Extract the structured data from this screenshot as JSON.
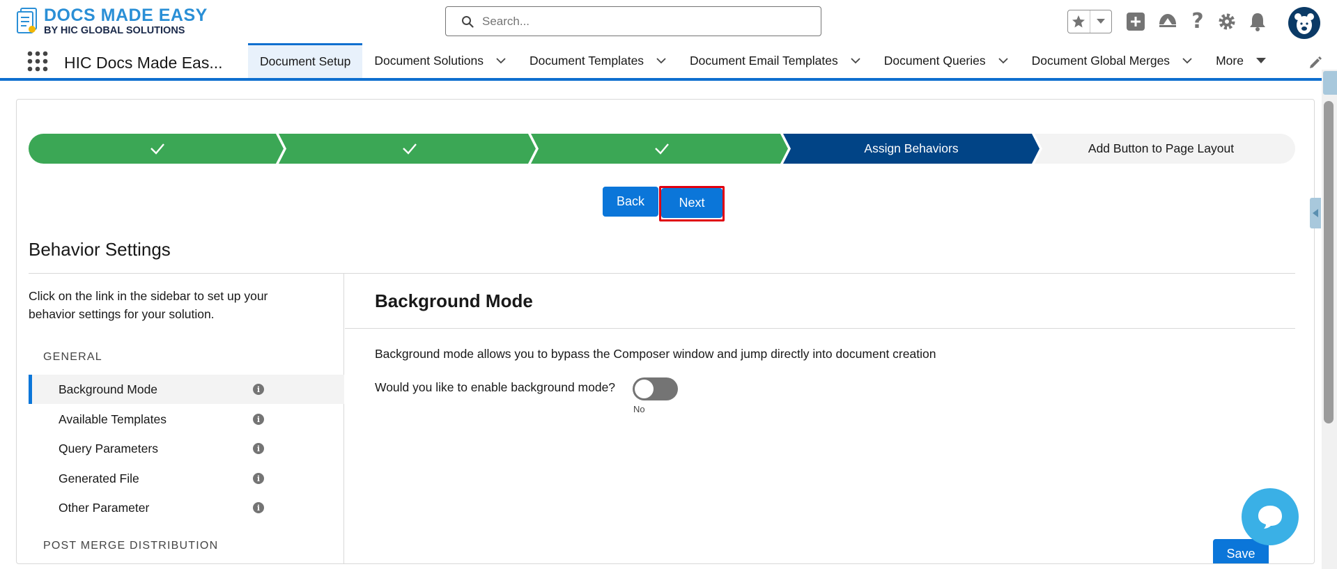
{
  "header": {
    "logo_title": "DOCS MADE EASY",
    "logo_subtitle": "BY HIC GLOBAL SOLUTIONS",
    "search_placeholder": "Search...",
    "icons": [
      "star-icon",
      "chevron-down-icon",
      "add-icon",
      "trailhead-icon",
      "help-icon",
      "setup-gear-icon",
      "notifications-bell-icon",
      "avatar"
    ]
  },
  "nav": {
    "app_name": "HIC Docs Made Eas...",
    "tabs": [
      {
        "label": "Document Setup",
        "active": true,
        "has_menu": false
      },
      {
        "label": "Document Solutions",
        "has_menu": true
      },
      {
        "label": "Document Templates",
        "has_menu": true
      },
      {
        "label": "Document Email Templates",
        "has_menu": true
      },
      {
        "label": "Document Queries",
        "has_menu": true
      },
      {
        "label": "Document Global Merges",
        "has_menu": true
      },
      {
        "label": "More",
        "has_menu": true
      }
    ]
  },
  "path": {
    "steps": [
      {
        "label": "",
        "state": "complete"
      },
      {
        "label": "",
        "state": "complete"
      },
      {
        "label": "",
        "state": "complete"
      },
      {
        "label": "Assign Behaviors",
        "state": "current"
      },
      {
        "label": "Add Button to Page Layout",
        "state": "incomplete"
      }
    ]
  },
  "buttons": {
    "back": "Back",
    "next": "Next",
    "save": "Save"
  },
  "section": {
    "title": "Behavior Settings"
  },
  "sidebar": {
    "intro": "Click on the link in the sidebar to set up your behavior settings for your solution.",
    "groups": [
      {
        "heading": "GENERAL",
        "items": [
          {
            "label": "Background Mode",
            "active": true
          },
          {
            "label": "Available Templates"
          },
          {
            "label": "Query Parameters"
          },
          {
            "label": "Generated File"
          },
          {
            "label": "Other Parameter"
          }
        ]
      },
      {
        "heading": "POST MERGE DISTRIBUTION",
        "items": []
      }
    ]
  },
  "pane": {
    "title": "Background Mode",
    "description": "Background mode allows you to bypass the Composer window and jump directly into document creation",
    "question": "Would you like to enable background mode?",
    "toggle_state": "No"
  },
  "colors": {
    "complete": "#3ba755",
    "current": "#014486",
    "incomplete": "#f3f3f3",
    "brand": "#0b76d9",
    "highlight": "#e00010"
  }
}
